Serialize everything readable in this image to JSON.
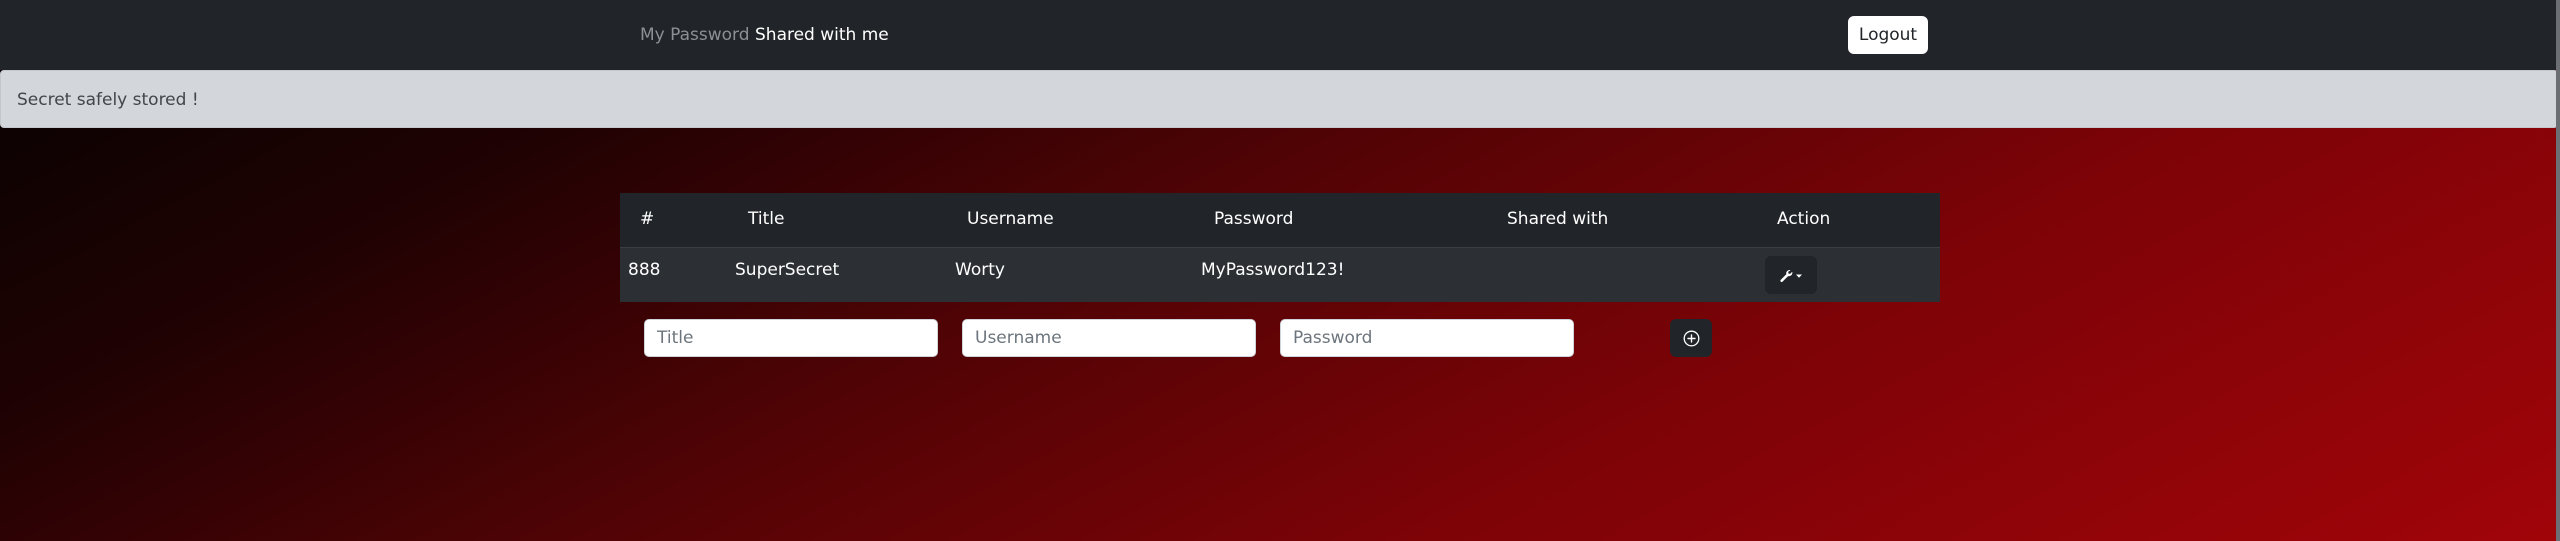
{
  "navbar": {
    "links": [
      {
        "label": "My Password"
      },
      {
        "label": "Shared with me"
      }
    ],
    "logout_label": "Logout"
  },
  "alert": {
    "message": "Secret safely stored !"
  },
  "table": {
    "headers": [
      "#",
      "Title",
      "Username",
      "Password",
      "Shared with",
      "Action"
    ],
    "rows": [
      {
        "id": "888",
        "title": "SuperSecret",
        "username": "Worty",
        "password": "MyPassword123!",
        "shared_with": "",
        "action_icon": "wrench-icon"
      }
    ]
  },
  "form": {
    "title_placeholder": "Title",
    "username_placeholder": "Username",
    "password_placeholder": "Password",
    "add_icon": "plus-circle-icon"
  },
  "colors": {
    "navbar_bg": "#212529",
    "alert_bg": "#d3d6db",
    "table_header_bg": "#212529",
    "table_row_bg": "#2c3034",
    "background_gradient": [
      "#050101",
      "#a00409"
    ]
  }
}
